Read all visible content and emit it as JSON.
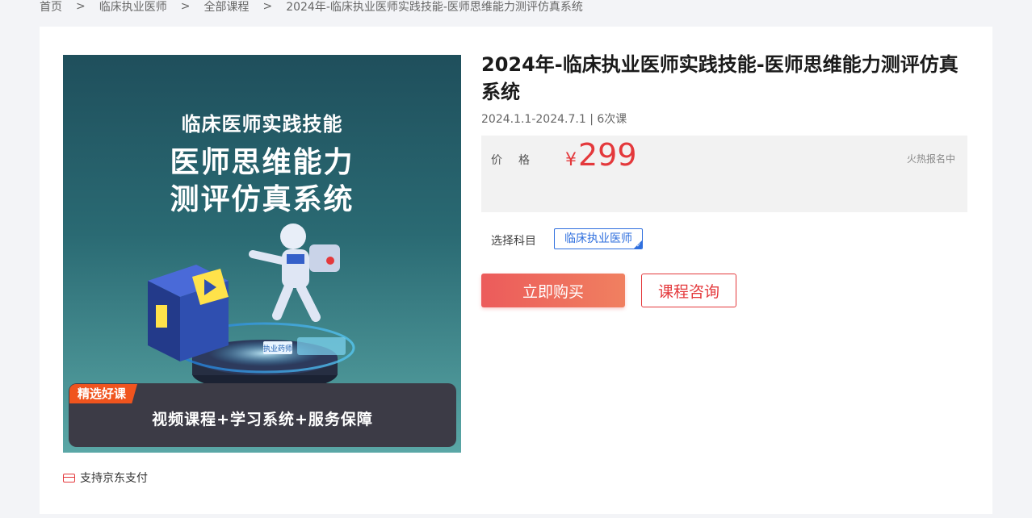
{
  "breadcrumb": {
    "items": [
      "首页",
      "临床执业医师",
      "全部课程",
      "2024年-临床执业医师实践技能-医师思维能力测评仿真系统"
    ],
    "separator": ">"
  },
  "cover": {
    "line1": "临床医师实践技能",
    "line2": "医师思维能力",
    "line3": "测评仿真系统",
    "tag": "精选好课",
    "banner": "视频课程+学习系统+服务保障",
    "sign_text": "执业药师"
  },
  "payment": {
    "icon": "card-icon",
    "label": "支持京东支付"
  },
  "course": {
    "title": "2024年-临床执业医师实践技能-医师思维能力测评仿真系统",
    "meta": "2024.1.1-2024.7.1 | 6次课"
  },
  "price": {
    "label": "价格",
    "currency": "¥",
    "amount": "299",
    "status": "火热报名中"
  },
  "subject": {
    "label": "选择科目",
    "selected": "临床执业医师"
  },
  "actions": {
    "buy_label": "立即购买",
    "consult_label": "课程咨询"
  },
  "colors": {
    "accent_red": "#e4393c",
    "selected_blue": "#2f6fde"
  }
}
